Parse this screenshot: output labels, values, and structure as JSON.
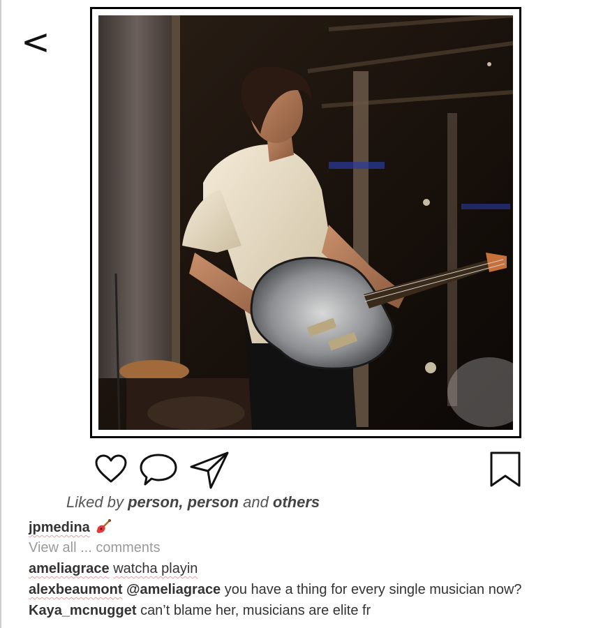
{
  "nav": {
    "back_label": "<"
  },
  "photo": {
    "subject": "guitarist-on-stage-photo"
  },
  "actions": {
    "like_icon": "heart-icon",
    "comment_icon": "comment-bubble-icon",
    "share_icon": "paper-plane-icon",
    "save_icon": "bookmark-icon"
  },
  "likes": {
    "prefix": "Liked by ",
    "names": "person, person",
    "middle": " and ",
    "others": "others"
  },
  "caption": {
    "username": "jpmedina",
    "emoji_icon": "guitar-icon"
  },
  "view_all_label": "View all ... comments",
  "comments": [
    {
      "username": "ameliagrace",
      "text": "watcha playin"
    },
    {
      "username": "alexbeaumont",
      "mention": "@ameliagrace",
      "text": " you have a thing for every single musician now?"
    },
    {
      "username": "Kaya_mcnugget",
      "text": "can’t blame her, musicians are elite fr"
    }
  ]
}
